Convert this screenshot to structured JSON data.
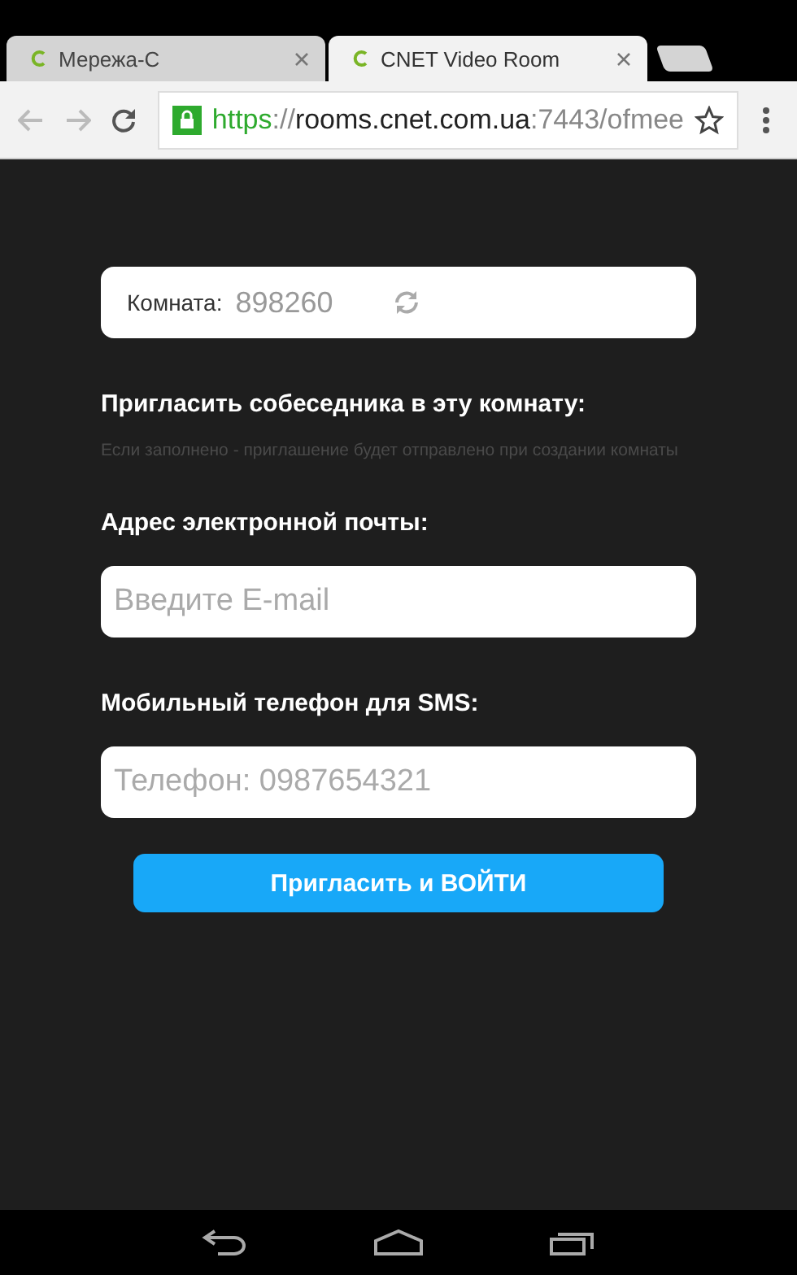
{
  "browser": {
    "tabs": [
      {
        "title": "Мережа-С",
        "selected": false
      },
      {
        "title": "CNET Video Room",
        "selected": true
      }
    ],
    "address": {
      "scheme": "https",
      "separator": "://",
      "host": "rooms.cnet.com.ua",
      "rest": ":7443/ofmee",
      "secure": true
    }
  },
  "room": {
    "label": "Комната:",
    "value": "898260"
  },
  "invite": {
    "heading": "Пригласить собеседника в эту комнату:",
    "hint": "Если заполнено - приглашение будет отправлено при создании комнаты"
  },
  "fields": [
    {
      "label": "Адрес электронной почты:",
      "placeholder": "Введите E-mail"
    },
    {
      "label": "Мобильный телефон для SMS:",
      "placeholder": "Телефон: 0987654321"
    }
  ],
  "button": "Пригласить и ВОЙТИ"
}
